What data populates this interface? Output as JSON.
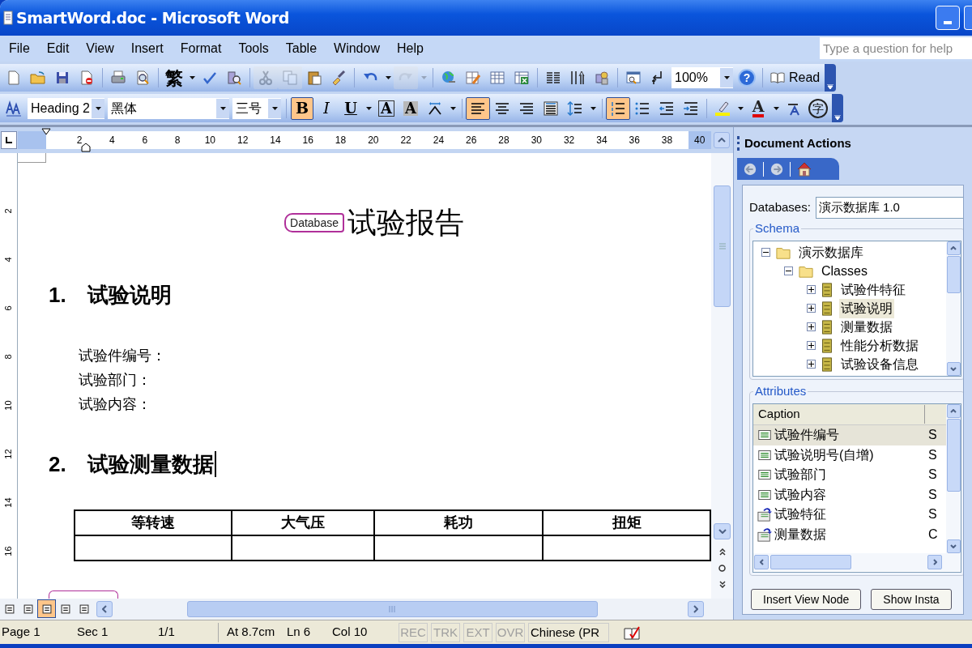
{
  "window": {
    "title": "SmartWord.doc - Microsoft Word"
  },
  "menu": [
    {
      "label": "File"
    },
    {
      "label": "Edit"
    },
    {
      "label": "View"
    },
    {
      "label": "Insert"
    },
    {
      "label": "Format"
    },
    {
      "label": "Tools"
    },
    {
      "label": "Table"
    },
    {
      "label": "Window"
    },
    {
      "label": "Help"
    }
  ],
  "help_box": {
    "placeholder": "Type a question for help"
  },
  "standard_toolbar": [
    {
      "kind": "button",
      "disabled": false
    },
    {
      "kind": "button",
      "disabled": false
    },
    {
      "kind": "button",
      "disabled": false
    },
    {
      "kind": "button",
      "disabled": false
    },
    {
      "kind": "sep"
    },
    {
      "kind": "button",
      "disabled": false
    },
    {
      "kind": "button",
      "disabled": false
    },
    {
      "kind": "sep"
    },
    {
      "kind": "glyph",
      "glyph": "繁",
      "disabled": false
    },
    {
      "kind": "drop",
      "disabled": false
    },
    {
      "kind": "button",
      "disabled": false
    },
    {
      "kind": "button",
      "disabled": false
    },
    {
      "kind": "sep"
    },
    {
      "kind": "button",
      "disabled": true
    },
    {
      "kind": "button",
      "disabled": true
    },
    {
      "kind": "button",
      "disabled": false
    },
    {
      "kind": "button",
      "disabled": false
    },
    {
      "kind": "sep"
    },
    {
      "kind": "button",
      "disabled": false
    },
    {
      "kind": "drop",
      "disabled": false
    },
    {
      "kind": "button",
      "disabled": true
    },
    {
      "kind": "drop",
      "disabled": true
    },
    {
      "kind": "sep"
    },
    {
      "kind": "button",
      "disabled": false
    },
    {
      "kind": "button",
      "disabled": false
    },
    {
      "kind": "button",
      "disabled": false
    },
    {
      "kind": "button",
      "disabled": false
    },
    {
      "kind": "sep"
    },
    {
      "kind": "button",
      "disabled": false
    },
    {
      "kind": "button",
      "disabled": false
    },
    {
      "kind": "button",
      "disabled": false
    },
    {
      "kind": "sep"
    },
    {
      "kind": "button",
      "disabled": false
    },
    {
      "kind": "button",
      "disabled": false
    },
    {
      "kind": "combo",
      "value": "100%"
    },
    {
      "kind": "glyph",
      "glyph": "?",
      "disabled": false
    },
    {
      "kind": "sep"
    },
    {
      "kind": "labeled",
      "label": "Read"
    }
  ],
  "formatting_toolbar": [
    {
      "kind": "button",
      "pressed": false
    },
    {
      "kind": "combo",
      "value": "Heading 2"
    },
    {
      "kind": "combo",
      "value": "黑体"
    },
    {
      "kind": "combo",
      "value": "三号"
    },
    {
      "kind": "sep"
    },
    {
      "kind": "glyph",
      "glyph": "B",
      "pressed": true
    },
    {
      "kind": "glyph",
      "glyph": "I",
      "pressed": false
    },
    {
      "kind": "glyph",
      "glyph": "U",
      "pressed": false
    },
    {
      "kind": "drop"
    },
    {
      "kind": "glyph",
      "glyph": "A",
      "pressed": false
    },
    {
      "kind": "glyph",
      "glyph": "A",
      "pressed": false
    },
    {
      "kind": "button",
      "pressed": false
    },
    {
      "kind": "drop"
    },
    {
      "kind": "sep"
    },
    {
      "kind": "button",
      "pressed": true
    },
    {
      "kind": "button",
      "pressed": false
    },
    {
      "kind": "button",
      "pressed": false
    },
    {
      "kind": "button",
      "pressed": false
    },
    {
      "kind": "button",
      "pressed": false
    },
    {
      "kind": "drop"
    },
    {
      "kind": "sep"
    },
    {
      "kind": "button",
      "pressed": true
    },
    {
      "kind": "button",
      "pressed": false
    },
    {
      "kind": "button",
      "pressed": false
    },
    {
      "kind": "button",
      "pressed": false
    },
    {
      "kind": "sep"
    },
    {
      "kind": "button",
      "pressed": false
    },
    {
      "kind": "drop"
    },
    {
      "kind": "glyph",
      "glyph": "A",
      "pressed": false
    },
    {
      "kind": "drop"
    },
    {
      "kind": "button",
      "pressed": false
    },
    {
      "kind": "glyph",
      "glyph": "字",
      "pressed": false
    }
  ],
  "ruler": {
    "ticks": [
      "2",
      "4",
      "6",
      "8",
      "10",
      "12",
      "14",
      "16",
      "18",
      "20",
      "22",
      "24",
      "26",
      "28",
      "30",
      "32",
      "34",
      "36",
      "38",
      "40"
    ]
  },
  "vertical_ruler": {
    "ticks": [
      "2",
      "4",
      "6",
      "8",
      "10",
      "12",
      "14",
      "16"
    ]
  },
  "document": {
    "xml_tag": "Database",
    "title": "试验报告",
    "sections": [
      {
        "number": "1.",
        "heading": "试验说明",
        "lines": [
          "试验件编号：",
          "试验部门：",
          "试验内容："
        ]
      },
      {
        "number": "2.",
        "heading": "试验测量数据"
      }
    ],
    "table": {
      "columns": [
        "等转速",
        "大气压",
        "耗功",
        "扭矩"
      ],
      "rows": [
        {
          "blank": true
        }
      ]
    }
  },
  "view_buttons": [
    {
      "selected": false
    },
    {
      "selected": false
    },
    {
      "selected": true
    },
    {
      "selected": false
    },
    {
      "selected": false
    }
  ],
  "task_pane": {
    "title": "Document Actions",
    "database_label": "Databases:",
    "database_value": "演示数据库 1.0",
    "schema": {
      "title": "Schema",
      "tree": [
        {
          "label": "演示数据库",
          "kind": "folder",
          "expanded": true,
          "selected": false,
          "children": [
            {
              "label": "Classes",
              "kind": "folder",
              "expanded": true,
              "selected": false,
              "children": [
                {
                  "label": "试验件特征",
                  "kind": "class",
                  "expanded": false,
                  "selected": false
                },
                {
                  "label": "试验说明",
                  "kind": "class",
                  "expanded": false,
                  "selected": true
                },
                {
                  "label": "测量数据",
                  "kind": "class",
                  "expanded": false,
                  "selected": false
                },
                {
                  "label": "性能分析数据",
                  "kind": "class",
                  "expanded": false,
                  "selected": false
                },
                {
                  "label": "试验设备信息",
                  "kind": "class",
                  "expanded": false,
                  "selected": false
                }
              ]
            }
          ]
        }
      ]
    },
    "attributes": {
      "title": "Attributes",
      "columns": [
        "Caption"
      ],
      "rows": [
        {
          "caption": "试验件编号",
          "column_2": "S",
          "kind": "field",
          "selected": true
        },
        {
          "caption": "试验说明号(自增)",
          "column_2": "S",
          "kind": "field",
          "selected": false
        },
        {
          "caption": "试验部门",
          "column_2": "S",
          "kind": "field",
          "selected": false
        },
        {
          "caption": "试验内容",
          "column_2": "S",
          "kind": "field",
          "selected": false
        },
        {
          "caption": "试验特征",
          "column_2": "S",
          "kind": "relation",
          "selected": false
        },
        {
          "caption": "测量数据",
          "column_2": "C",
          "kind": "relation",
          "selected": false
        }
      ]
    },
    "buttons": [
      "Insert View Node",
      "Show Insta"
    ]
  },
  "status_bar": {
    "fields": [
      "Page 1",
      "Sec 1",
      "1/1",
      "At 8.7cm",
      "Ln 6",
      "Col 10"
    ],
    "modes": [
      {
        "label": "REC",
        "on": false
      },
      {
        "label": "TRK",
        "on": false
      },
      {
        "label": "EXT",
        "on": false
      },
      {
        "label": "OVR",
        "on": false
      }
    ],
    "language": "Chinese (PR"
  }
}
